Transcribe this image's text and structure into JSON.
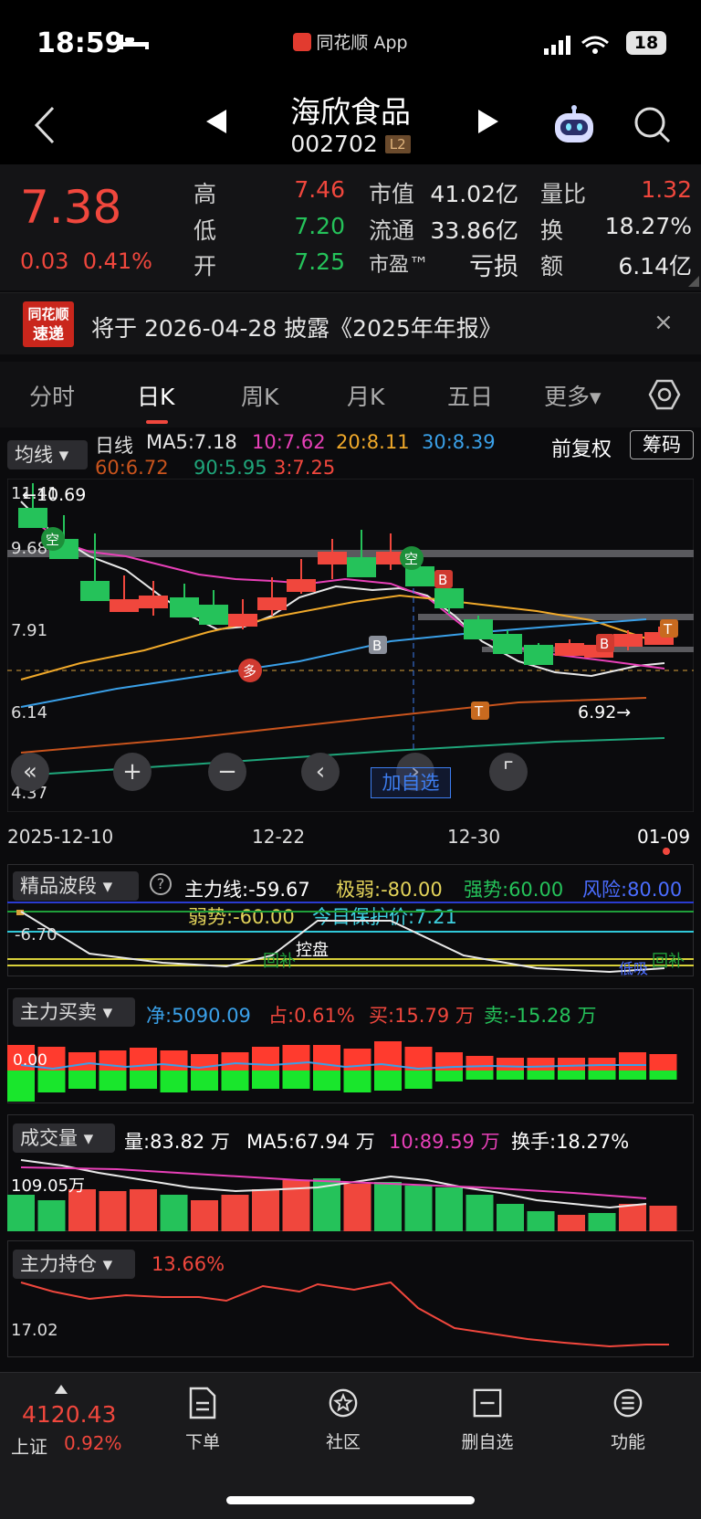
{
  "status_bar": {
    "time": "18:59",
    "app_name": "同花顺 App",
    "battery": "18"
  },
  "header": {
    "stock_name": "海欣食品",
    "stock_code": "002702",
    "level_badge": "L2"
  },
  "quote": {
    "price": "7.38",
    "change": "0.03",
    "change_pct": "0.41%",
    "high_label": "高",
    "high": "7.46",
    "low_label": "低",
    "low": "7.20",
    "open_label": "开",
    "open": "7.25",
    "mcap_label": "市值",
    "mcap": "41.02亿",
    "float_label": "流通",
    "float": "33.86亿",
    "pe_label": "市盈™",
    "pe": "亏损",
    "vol_ratio_label": "量比",
    "vol_ratio": "1.32",
    "turnover_label": "换",
    "turnover": "18.27%",
    "amount_label": "额",
    "amount": "6.14亿"
  },
  "notice": {
    "badge_line1": "同花顺",
    "badge_line2": "速递",
    "text": "将于 2026-04-28 披露《2025年年报》",
    "close": "×"
  },
  "tabs": [
    "分时",
    "日K",
    "周K",
    "月K",
    "五日",
    "更多▾"
  ],
  "tabs_active": "日K",
  "kline_legend": {
    "ma_button": "均线 ▾",
    "period": "日线",
    "ma5": "MA5:7.18",
    "ma10": "10:7.62",
    "ma20": "20:8.11",
    "ma30": "30:8.39",
    "ma60": "60:6.72",
    "ma90": "90:5.95",
    "ma3": "3:7.25",
    "adjust": "前复权",
    "chips": "筹码"
  },
  "kline_axis": {
    "top": "11.41",
    "max_marker": "←10.69",
    "y1": "9.68",
    "y2": "7.91",
    "y3": "6.14",
    "bottom": "4.37",
    "min_marker": "6.92→"
  },
  "kline_signals": {
    "kong1": "空",
    "kong2": "空",
    "duo": "多",
    "b1": "B",
    "b2": "B",
    "b3": "B",
    "t1": "T",
    "t2": "T"
  },
  "chart_controls": {
    "add_watch": "加自选"
  },
  "dates": [
    "2025-12-10",
    "12-22",
    "12-30",
    "01-09"
  ],
  "panel1": {
    "name": "精品波段 ▾",
    "help": "?",
    "main_line": "主力线:-59.67",
    "extreme_weak": "极弱:-80.00",
    "strong": "强势:60.00",
    "risk": "风险:80.00",
    "weak": "弱势:-60.00",
    "protect": "今日保护价:7.21",
    "axis": "-6.70",
    "label_control": "控盘",
    "label_back1": "回补",
    "label_back2": "回补",
    "label_low": "低吸"
  },
  "panel2": {
    "name": "主力买卖 ▾",
    "net": "净:5090.09",
    "ratio": "占:0.61%",
    "buy": "买:15.79 万",
    "sell": "卖:-15.28 万",
    "axis": "0.00"
  },
  "panel3": {
    "name": "成交量 ▾",
    "vol": "量:83.82 万",
    "ma5": "MA5:67.94 万",
    "ma10": "10:89.59 万",
    "turnover": "换手:18.27%",
    "axis": "109.05万"
  },
  "panel4": {
    "name": "主力持仓 ▾",
    "value": "13.66%",
    "axis": "17.02"
  },
  "bottom_nav": {
    "index_value": "4120.43",
    "index_name": "上证",
    "index_change": "0.92%",
    "items": [
      "下单",
      "社区",
      "删自选",
      "功能"
    ]
  },
  "colors": {
    "up": "#f0473d",
    "down": "#25c25a",
    "ma5": "#e8e8e8",
    "ma10": "#e840b8",
    "ma20": "#f0a92a",
    "ma30": "#3aa0e8",
    "ma60": "#c9541d",
    "ma90": "#1fa57a"
  },
  "icons": [
    "back-icon",
    "prev-triangle-icon",
    "next-triangle-icon",
    "robot-icon",
    "search-icon",
    "settings-hexagon-icon",
    "close-icon",
    "order-icon",
    "community-icon",
    "delete-watch-icon",
    "menu-icon"
  ]
}
